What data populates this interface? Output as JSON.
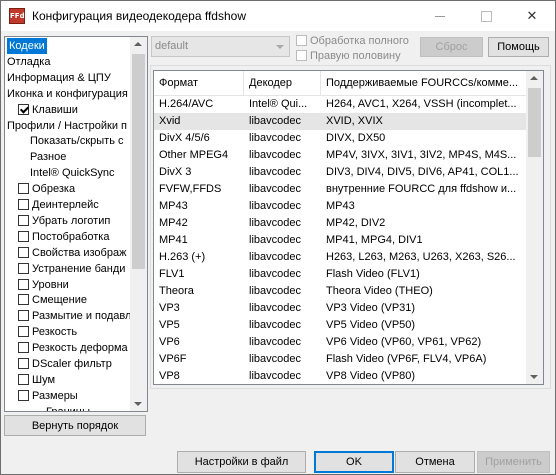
{
  "window": {
    "title": "Конфигурация видеодекодера ffdshow",
    "icon_text": "FFd",
    "controls": {
      "minimize": "—",
      "maximize": "☐",
      "close": "✕"
    }
  },
  "tree": {
    "items": [
      {
        "label": "Кодеки",
        "selected": true,
        "indent": 0,
        "checkbox": false
      },
      {
        "label": "Отладка",
        "indent": 0,
        "checkbox": false
      },
      {
        "label": "Информация & ЦПУ",
        "indent": 0,
        "checkbox": false
      },
      {
        "label": "Иконка и конфигурация",
        "indent": 0,
        "checkbox": false
      },
      {
        "label": "Клавиши",
        "indent": 1,
        "checkbox": true,
        "checked": true
      },
      {
        "label": "Профили / Настройки п",
        "indent": 0,
        "checkbox": false
      },
      {
        "label": "Показать/скрыть с",
        "indent": 2,
        "checkbox": false
      },
      {
        "label": "Разное",
        "indent": 2,
        "checkbox": false
      },
      {
        "label": "Intel® QuickSync",
        "indent": 2,
        "checkbox": false
      },
      {
        "label": "Обрезка",
        "indent": 1,
        "checkbox": true,
        "checked": false
      },
      {
        "label": "Деинтерлейс",
        "indent": 1,
        "checkbox": true,
        "checked": false
      },
      {
        "label": "Убрать логотип",
        "indent": 1,
        "checkbox": true,
        "checked": false
      },
      {
        "label": "Постобработка",
        "indent": 1,
        "checkbox": true,
        "checked": false
      },
      {
        "label": "Свойства изображ",
        "indent": 1,
        "checkbox": true,
        "checked": false
      },
      {
        "label": "Устранение банди",
        "indent": 1,
        "checkbox": true,
        "checked": false
      },
      {
        "label": "Уровни",
        "indent": 1,
        "checkbox": true,
        "checked": false
      },
      {
        "label": "Смещение",
        "indent": 1,
        "checkbox": true,
        "checked": false
      },
      {
        "label": "Размытие и подавл",
        "indent": 1,
        "checkbox": true,
        "checked": false
      },
      {
        "label": "Резкость",
        "indent": 1,
        "checkbox": true,
        "checked": false
      },
      {
        "label": "Резкость деформа",
        "indent": 1,
        "checkbox": true,
        "checked": false
      },
      {
        "label": "DScaler фильтр",
        "indent": 1,
        "checkbox": true,
        "checked": false
      },
      {
        "label": "Шум",
        "indent": 1,
        "checkbox": true,
        "checked": false
      },
      {
        "label": "Размеры",
        "indent": 1,
        "checkbox": true,
        "checked": false
      },
      {
        "label": "Границы",
        "indent": 3,
        "checkbox": false
      }
    ]
  },
  "preset": {
    "value": "default"
  },
  "options": {
    "full_processing": "Обработка полного",
    "right_half": "Правую половину"
  },
  "buttons": {
    "reset": "Сброс",
    "help": "Помощь",
    "restore_order": "Вернуть порядок",
    "save_to_file": "Настройки в файл",
    "ok": "OK",
    "cancel": "Отмена",
    "apply": "Применить"
  },
  "codecs_table": {
    "columns": [
      "Формат",
      "Декодер",
      "Поддерживаемые FOURCCs/комме..."
    ],
    "rows": [
      [
        "H.264/AVC",
        "Intel® Qui...",
        "H264, AVC1, X264, VSSH (incomplet..."
      ],
      [
        "Xvid",
        "libavcodec",
        "XVID, XVIX"
      ],
      [
        "DivX 4/5/6",
        "libavcodec",
        "DIVX, DX50"
      ],
      [
        "Other MPEG4",
        "libavcodec",
        "MP4V, 3IVX, 3IV1, 3IV2, MP4S, M4S..."
      ],
      [
        "DivX 3",
        "libavcodec",
        "DIV3, DIV4, DIV5, DIV6, AP41, COL1..."
      ],
      [
        "FVFW,FFDS",
        "libavcodec",
        "внутренние FOURCC для ffdshow и..."
      ],
      [
        "MP43",
        "libavcodec",
        "MP43"
      ],
      [
        "MP42",
        "libavcodec",
        "MP42, DIV2"
      ],
      [
        "MP41",
        "libavcodec",
        "MP41, MPG4, DIV1"
      ],
      [
        "H.263 (+)",
        "libavcodec",
        "H263, L263, M263, U263, X263, S26..."
      ],
      [
        "FLV1",
        "libavcodec",
        "Flash Video (FLV1)"
      ],
      [
        "Theora",
        "libavcodec",
        "Theora Video (THEO)"
      ],
      [
        "VP3",
        "libavcodec",
        "VP3 Video (VP31)"
      ],
      [
        "VP5",
        "libavcodec",
        "VP5 Video (VP50)"
      ],
      [
        "VP6",
        "libavcodec",
        "VP6 Video (VP60, VP61, VP62)"
      ],
      [
        "VP6F",
        "libavcodec",
        "Flash Video (VP6F, FLV4, VP6A)"
      ],
      [
        "VP8",
        "libavcodec",
        "VP8 Video (VP80)"
      ]
    ],
    "selected_row": 1
  }
}
